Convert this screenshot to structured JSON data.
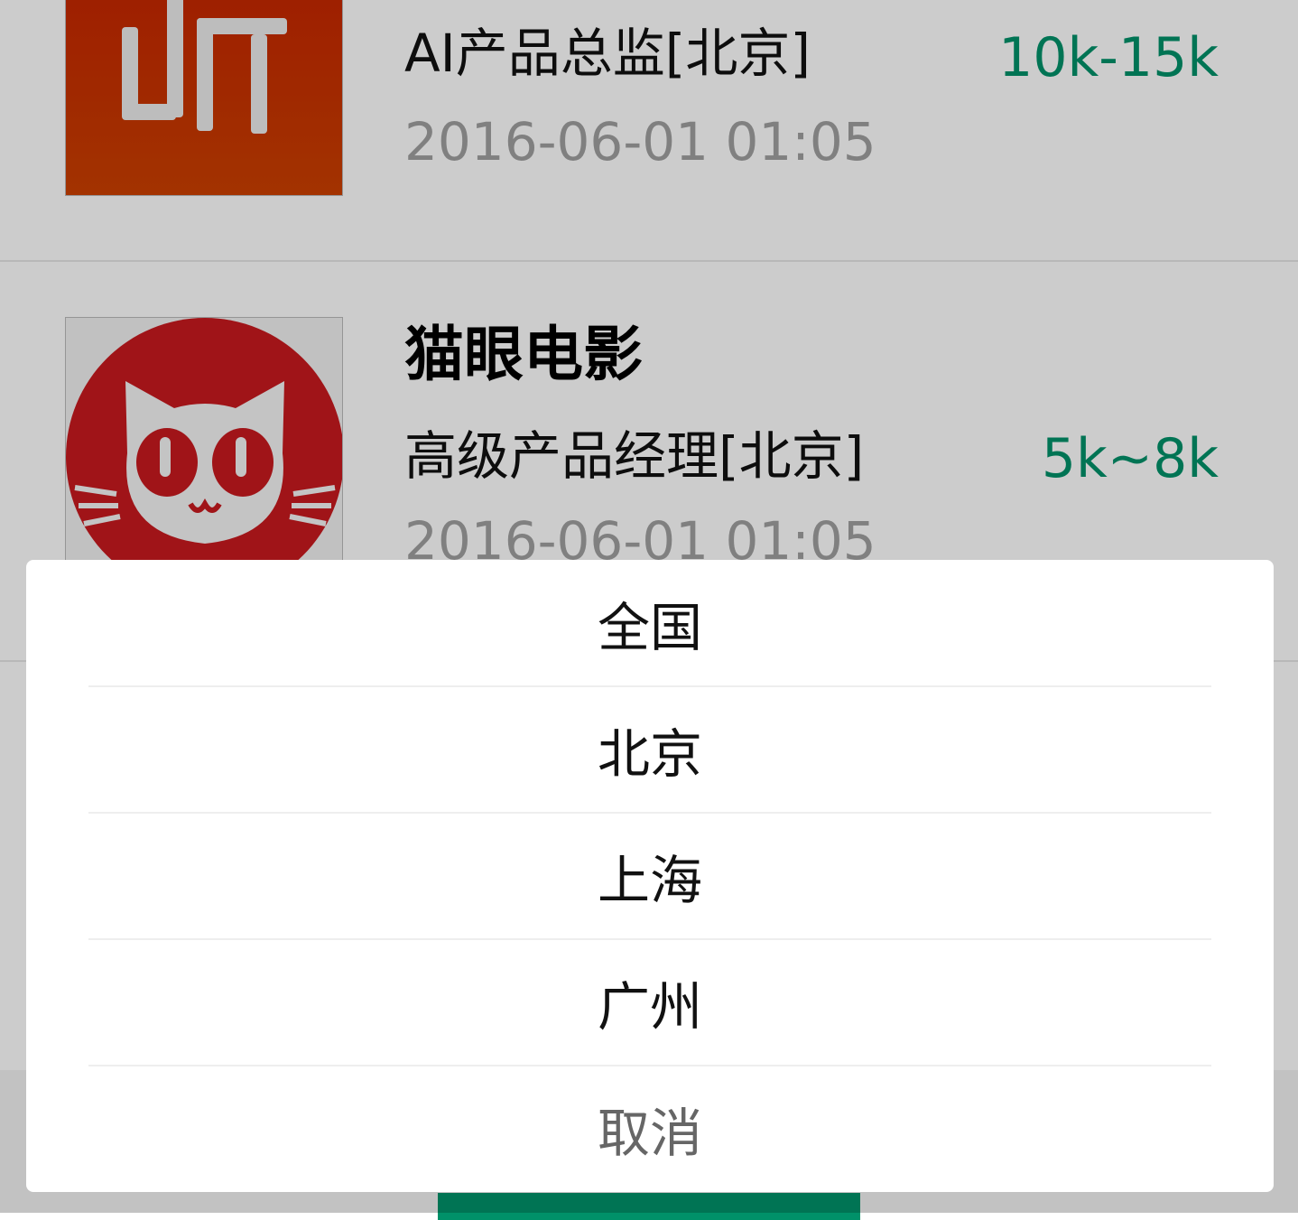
{
  "jobs": [
    {
      "company": "",
      "title": "AI产品总监[北京]",
      "salary": "10k-15k",
      "time": "2016-06-01 01:05",
      "logo_text": "听"
    },
    {
      "company": "猫眼电影",
      "title": "高级产品经理[北京]",
      "salary": "5k~8k",
      "time": "2016-06-01 01:05",
      "logo_text": ""
    }
  ],
  "action_sheet": {
    "options": [
      "全国",
      "北京",
      "上海",
      "广州"
    ],
    "cancel_label": "取消"
  },
  "colors": {
    "salary": "#009169",
    "accent": "#009169",
    "logo1_top": "#c41e00",
    "logo1_bottom": "#cc4000",
    "logo2_red": "#c81a1f"
  }
}
